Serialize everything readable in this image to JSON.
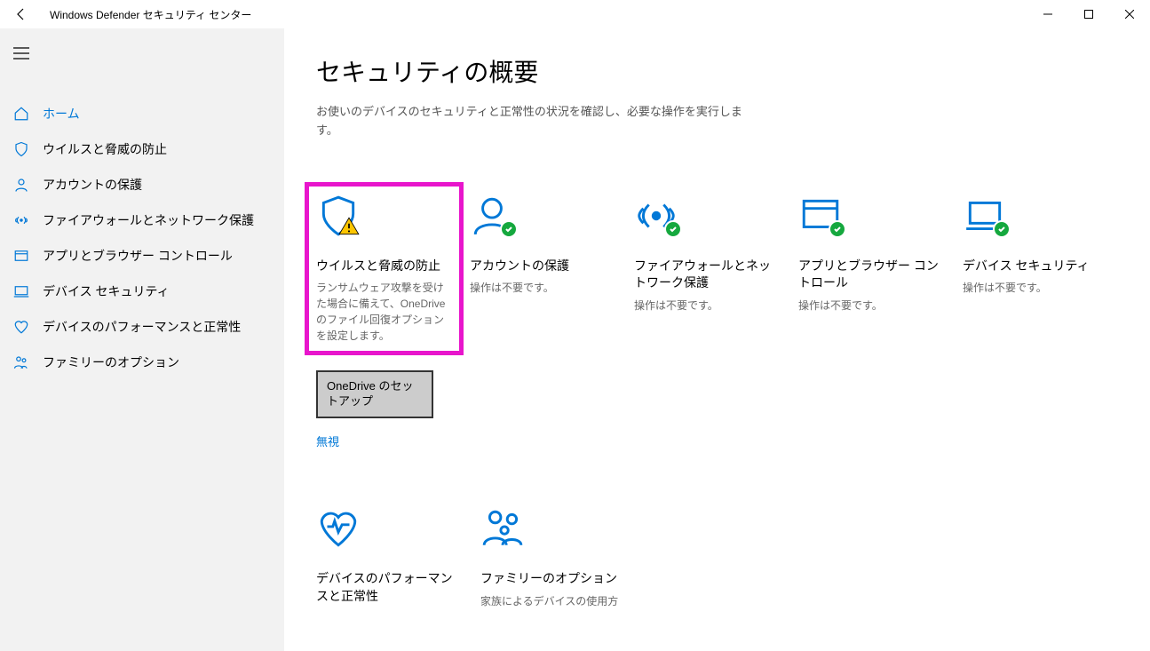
{
  "window": {
    "title": "Windows Defender セキュリティ センター"
  },
  "sidebar": {
    "items": [
      {
        "label": "ホーム"
      },
      {
        "label": "ウイルスと脅威の防止"
      },
      {
        "label": "アカウントの保護"
      },
      {
        "label": "ファイアウォールとネットワーク保護"
      },
      {
        "label": "アプリとブラウザー コントロール"
      },
      {
        "label": "デバイス セキュリティ"
      },
      {
        "label": "デバイスのパフォーマンスと正常性"
      },
      {
        "label": "ファミリーのオプション"
      }
    ]
  },
  "page": {
    "title": "セキュリティの概要",
    "subtitle": "お使いのデバイスのセキュリティと正常性の状況を確認し、必要な操作を実行します。"
  },
  "cards": {
    "virus": {
      "title": "ウイルスと脅威の防止",
      "desc": "ランサムウェア攻撃を受けた場合に備えて、OneDrive のファイル回復オプションを設定します。",
      "action": "OneDrive のセットアップ",
      "ignore": "無視"
    },
    "account": {
      "title": "アカウントの保護",
      "desc": "操作は不要です。"
    },
    "firewall": {
      "title": "ファイアウォールとネットワーク保護",
      "desc": "操作は不要です。"
    },
    "appbrowser": {
      "title": "アプリとブラウザー コントロール",
      "desc": "操作は不要です。"
    },
    "device": {
      "title": "デバイス セキュリティ",
      "desc": "操作は不要です。"
    },
    "health": {
      "title": "デバイスのパフォーマンスと正常性",
      "desc": ""
    },
    "family": {
      "title": "ファミリーのオプション",
      "desc": "家族によるデバイスの使用方"
    }
  }
}
